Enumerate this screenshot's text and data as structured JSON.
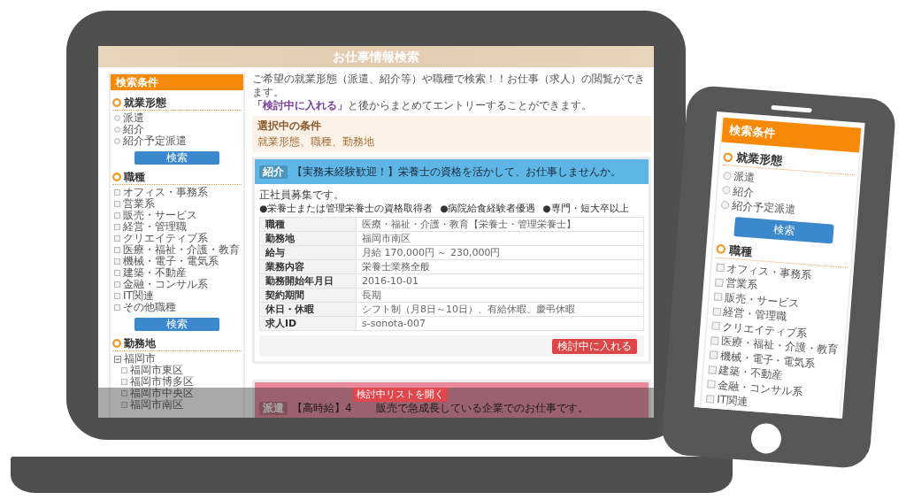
{
  "laptop": {
    "page_title": "お仕事情報検索",
    "sidebar": {
      "title": "検索条件",
      "sections": [
        {
          "kind": "radio",
          "heading": "就業形態",
          "options": [
            {
              "label": "派遣",
              "checked": false
            },
            {
              "label": "紹介",
              "checked": false
            },
            {
              "label": "紹介予定派遣",
              "checked": false
            }
          ],
          "button": "検索"
        },
        {
          "kind": "checkbox",
          "heading": "職種",
          "options": [
            {
              "label": "オフィス・事務系",
              "checked": false
            },
            {
              "label": "営業系",
              "checked": false
            },
            {
              "label": "販売・サービス",
              "checked": false
            },
            {
              "label": "経営・管理職",
              "checked": false
            },
            {
              "label": "クリエイティブ系",
              "checked": false
            },
            {
              "label": "医療・福祉・介護・教育",
              "checked": false
            },
            {
              "label": "機械・電子・電気系",
              "checked": false
            },
            {
              "label": "建築・不動産",
              "checked": false
            },
            {
              "label": "金融・コンサル系",
              "checked": false
            },
            {
              "label": "IT関連",
              "checked": false
            },
            {
              "label": "その他職種",
              "checked": false
            }
          ],
          "button": "検索"
        },
        {
          "kind": "tree",
          "heading": "勤務地",
          "nodes": [
            {
              "label": "福岡市",
              "expanded": true,
              "children": [
                {
                  "label": "福岡市東区",
                  "checked": false
                },
                {
                  "label": "福岡市博多区",
                  "checked": false
                },
                {
                  "label": "福岡市中央区",
                  "checked": false
                },
                {
                  "label": "福岡市南区",
                  "checked": false
                }
              ]
            }
          ]
        }
      ]
    },
    "intro": [
      "ご希望の就業形態（派遣、紹介等）や職種で検索！！お仕事（求人）の閲覧ができます。",
      "**「検討中に入れる」**と後からまとめてエントリーすることができます。"
    ],
    "selected_conditions": {
      "title": "選択中の条件",
      "value": "就業形態、職種、勤務地"
    },
    "jobs": [
      {
        "kind": "full",
        "color": "#5db6e6",
        "badge": "紹介",
        "title": "【実務未経験歓迎！】栄養士の資格を活かして、お仕事しませんか。",
        "lead": "正社員募集です。",
        "points": [
          "●栄養士または管理栄養士の資格取得者",
          "●病院給食経験者優遇",
          "●専門・短大卒以上"
        ],
        "details": [
          {
            "label": "職種",
            "value": "医療・福祉・介護・教育【栄養士・管理栄養士】"
          },
          {
            "label": "勤務地",
            "value": "福岡市南区"
          },
          {
            "label": "給与",
            "value": "月給 170,000円 ～ 230,000円"
          },
          {
            "label": "業務内容",
            "value": "栄養士業務全般"
          },
          {
            "label": "勤務開始年月日",
            "value": "2016-10-01"
          },
          {
            "label": "契約期間",
            "value": "長期"
          },
          {
            "label": "休日・休暇",
            "value": "シフト制（月8日～10日）、有給休暇、慶弔休暇"
          },
          {
            "label": "求人ID",
            "value": "s-sonota-007"
          }
        ],
        "action": "検討中に入れる"
      },
      {
        "kind": "partial",
        "color": "#e8889b",
        "badge": "派遣",
        "title_parts": [
          "【高時給】4",
          "販売で急成長している企業でのお仕事です。"
        ]
      }
    ],
    "list_button": "検討中リストを開く"
  },
  "phone": {
    "sidebar": {
      "title": "検索条件",
      "sections": [
        {
          "kind": "radio",
          "heading": "就業形態",
          "options": [
            {
              "label": "派遣",
              "checked": false
            },
            {
              "label": "紹介",
              "checked": false
            },
            {
              "label": "紹介予定派遣",
              "checked": false
            }
          ],
          "button": "検索"
        },
        {
          "kind": "checkbox",
          "heading": "職種",
          "options": [
            {
              "label": "オフィス・事務系",
              "checked": false
            },
            {
              "label": "営業系",
              "checked": false
            },
            {
              "label": "販売・サービス",
              "checked": false
            },
            {
              "label": "経営・管理職",
              "checked": false
            },
            {
              "label": "クリエイティブ系",
              "checked": false
            },
            {
              "label": "医療・福祉・介護・教育",
              "checked": false
            },
            {
              "label": "機械・電子・電気系",
              "checked": false
            },
            {
              "label": "建築・不動産",
              "checked": false
            },
            {
              "label": "金融・コンサル系",
              "checked": false
            },
            {
              "label": "IT関連",
              "checked": false
            }
          ]
        }
      ]
    }
  }
}
